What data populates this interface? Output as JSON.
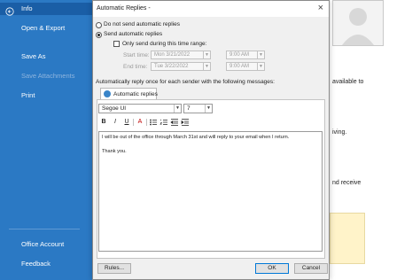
{
  "sidebar": {
    "items": [
      {
        "label": "Info"
      },
      {
        "label": "Open & Export"
      },
      {
        "label": "Save As"
      },
      {
        "label": "Save Attachments"
      },
      {
        "label": "Print"
      },
      {
        "label": "Office Account"
      },
      {
        "label": "Feedback"
      }
    ]
  },
  "background": {
    "fragments": [
      "available to",
      "iving.",
      "nd receive"
    ]
  },
  "dialog": {
    "title": "Automatic Replies -",
    "options": {
      "no_send": "Do not send automatic replies",
      "send": "Send automatic replies",
      "only_range": "Only send during this time range:"
    },
    "start_time_label": "Start time:",
    "start_date": "Mon 3/21/2022",
    "start_hour": "9:00 AM",
    "end_time_label": "End time:",
    "end_date": "Tue 3/22/2022",
    "end_hour": "9:00 AM",
    "auto_reply_caption": "Automatically reply once for each sender with the following messages:",
    "tab_label": "Automatic replies",
    "font_name": "Segoe UI",
    "font_size": "7",
    "format_buttons": [
      "B",
      "I",
      "U",
      "A"
    ],
    "message_lines": [
      "I will be out of the office through March 31st and will reply to your email when I return.",
      "",
      "Thank you."
    ],
    "rules_button": "Rules...",
    "ok_button": "OK",
    "cancel_button": "Cancel"
  }
}
